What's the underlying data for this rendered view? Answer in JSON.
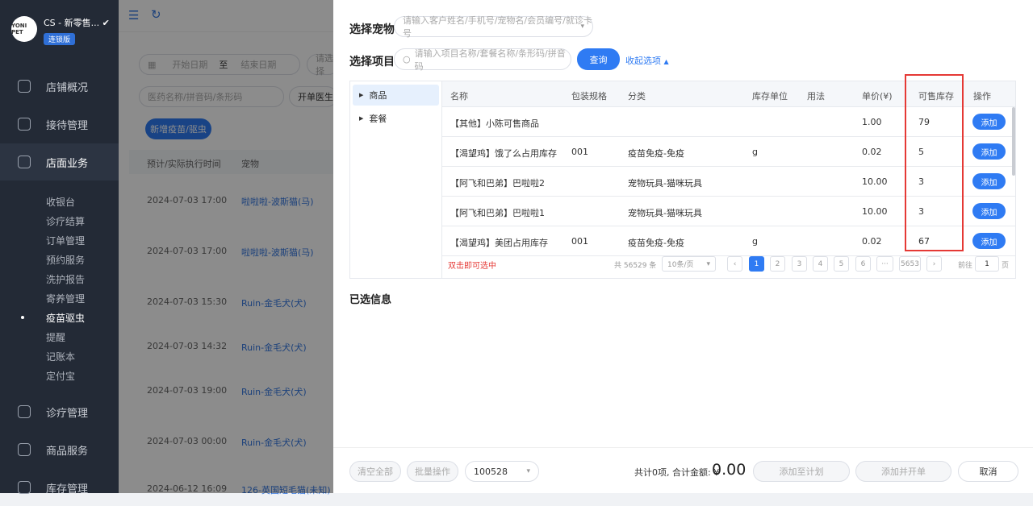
{
  "sidebar": {
    "logo_text": "YONI PET",
    "store_name": "CS - 新零售...",
    "badge": "连锁版",
    "nav": [
      {
        "label": "店铺概况"
      },
      {
        "label": "接待管理"
      },
      {
        "label": "店面业务"
      },
      {
        "label": "诊疗管理"
      },
      {
        "label": "商品服务"
      },
      {
        "label": "库存管理"
      }
    ],
    "sub_items": [
      "收银台",
      "诊疗结算",
      "订单管理",
      "预约服务",
      "洗护报告",
      "寄养管理",
      "疫苗驱虫",
      "提醒",
      "记账本",
      "定付宝"
    ]
  },
  "background": {
    "start_date": "开始日期",
    "to": "至",
    "end_date": "结束日期",
    "select_ph": "请选择",
    "drug_ph": "医药名称/拼音码/条形码",
    "doctor": "开单医生",
    "add_btn": "新增疫苗/驱虫",
    "col_time": "预计/实际执行时间",
    "col_pet": "宠物",
    "rows": [
      {
        "time": "2024-07-03 17:00",
        "pet": "啦啦啦-波斯猫(马)"
      },
      {
        "time": "2024-07-03 17:00",
        "pet": "啦啦啦-波斯猫(马)"
      },
      {
        "time": "2024-07-03 15:30",
        "pet": "Ruin-金毛犬(犬)"
      },
      {
        "time": "2024-07-03 14:32",
        "pet": "Ruin-金毛犬(犬)"
      },
      {
        "time": "2024-07-03 19:00",
        "pet": "Ruin-金毛犬(犬)"
      },
      {
        "time": "2024-07-03 00:00",
        "pet": "Ruin-金毛犬(犬)"
      },
      {
        "time": "2024-06-12 16:09",
        "pet": "126-英国短毛猫(未知)"
      }
    ]
  },
  "panel": {
    "select_pet_label": "选择宠物",
    "pet_ph": "请输入客户姓名/手机号/宠物名/会员编号/就诊卡号",
    "select_item_label": "选择项目",
    "item_ph": "请输入项目名称/套餐名称/条形码/拼音码",
    "query_btn": "查询",
    "collapse": "收起选项",
    "tree": [
      "商品",
      "套餐"
    ],
    "headers": [
      "名称",
      "包装规格",
      "分类",
      "库存单位",
      "用法",
      "单价(¥)",
      "可售库存",
      "操作"
    ],
    "rows": [
      {
        "name": "【其他】小陈可售商品",
        "spec": "",
        "cat": "",
        "unit": "",
        "usage": "",
        "price": "1.00",
        "stock": "79",
        "op": "添加"
      },
      {
        "name": "【渴望鸡】饿了么占用库存",
        "spec": "001",
        "cat": "疫苗免疫-免疫",
        "unit": "g",
        "usage": "",
        "price": "0.02",
        "stock": "5",
        "op": "添加"
      },
      {
        "name": "【阿飞和巴弟】巴啦啦2",
        "spec": "",
        "cat": "宠物玩具-猫咪玩具",
        "unit": "",
        "usage": "",
        "price": "10.00",
        "stock": "3",
        "op": "添加"
      },
      {
        "name": "【阿飞和巴弟】巴啦啦1",
        "spec": "",
        "cat": "宠物玩具-猫咪玩具",
        "unit": "",
        "usage": "",
        "price": "10.00",
        "stock": "3",
        "op": "添加"
      },
      {
        "name": "【渴望鸡】美团占用库存",
        "spec": "001",
        "cat": "疫苗免疫-免疫",
        "unit": "g",
        "usage": "",
        "price": "0.02",
        "stock": "67",
        "op": "添加"
      }
    ],
    "hint": "双击即可选中",
    "total": "共 56529 条",
    "page_size": "10条/页",
    "pages": [
      "1",
      "2",
      "3",
      "4",
      "5",
      "6",
      "···",
      "5653"
    ],
    "goto_label": "前往",
    "goto_value": "1",
    "page_unit": "页",
    "selected_info": "已选信息"
  },
  "footer": {
    "clear_all": "清空全部",
    "batch": "批量操作",
    "code": "100528",
    "summary": "共计0项, 合计金额: ¥",
    "amount": "0.00",
    "add_plan": "添加至计划",
    "add_open": "添加并开单",
    "cancel": "取消"
  },
  "colors": {
    "accent": "#2f7bf3",
    "sidebar": "#232a36",
    "highlight_box": "#e53935"
  }
}
